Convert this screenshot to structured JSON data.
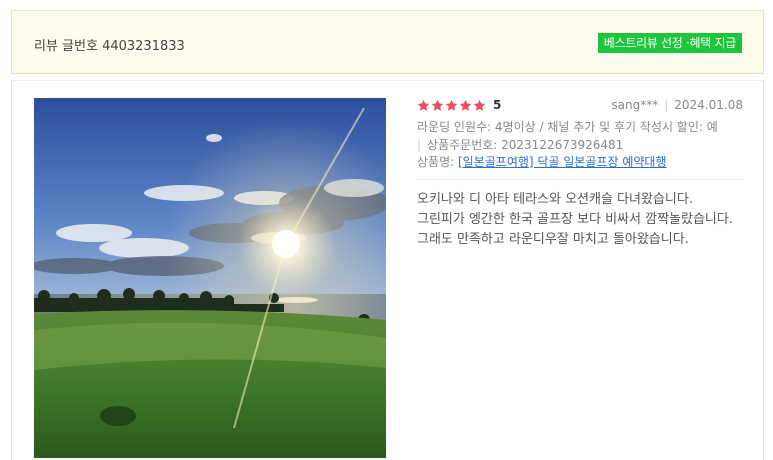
{
  "header": {
    "review_number": "리뷰 글번호 4403231833",
    "best_badge": "베스트리뷰 선정 ·혜택 지급"
  },
  "review": {
    "rating": 5,
    "rating_text": "5",
    "author": "sang***",
    "date": "2024.01.08",
    "options_line": "라운딩 인원수: 4명이상 / 채널 추가 및 후기 작성시 할인: 예",
    "order_line": "상품주문번호: 2023122673926481",
    "product_label": "상품명:",
    "product_name": "[일본골프여행] 닥골 일본골프장 예약대행",
    "body": "오키나와 디 아타 테라스와 오션캐슬 다녀왔습니다. 그린피가 엥간한 한국 골프장 보다 비싸서 깜짝놀랐습니다. 그래도 만족하고 라운디우잘 마치고 돌아왔습니다.",
    "photo_alt": "golf-course-sunset-photo"
  },
  "colors": {
    "star": "#f04b5b",
    "badge": "#1ec43a",
    "header_bg": "#fdfcec",
    "link": "#2a6fc9"
  }
}
